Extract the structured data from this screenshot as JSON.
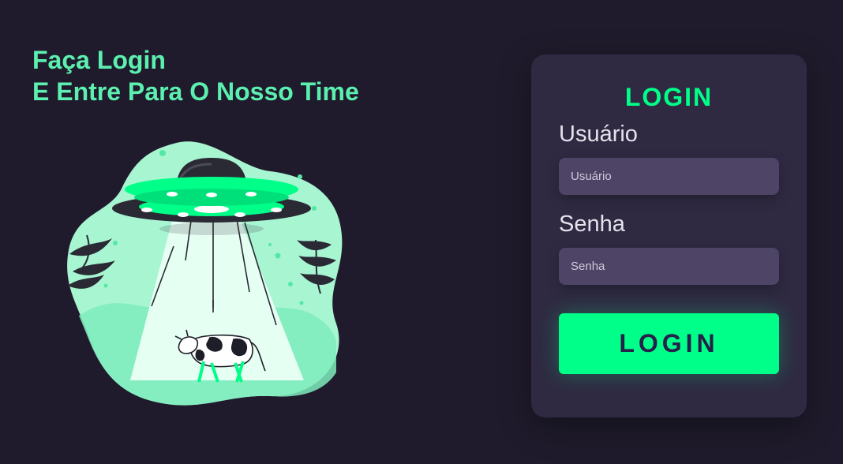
{
  "headline": {
    "line1": "Faça Login",
    "line2": "E Entre Para O Nosso Time"
  },
  "illustration": {
    "subject": "ufo-abducting-cow",
    "colors": {
      "mint": "#a8f5d2",
      "green": "#00ff88",
      "dark": "#2a2a35",
      "beam": "#e6fff3"
    }
  },
  "login_card": {
    "title": "LOGIN",
    "username": {
      "label": "Usuário",
      "placeholder": "Usuário",
      "value": ""
    },
    "password": {
      "label": "Senha",
      "placeholder": "Senha",
      "value": ""
    },
    "submit_label": "LOGIN"
  },
  "theme": {
    "background": "#1f1b2c",
    "card": "#2f2a42",
    "input": "#4d4466",
    "accent": "#00ff88",
    "headline": "#5cf0b0",
    "button_text": "#26204a"
  }
}
